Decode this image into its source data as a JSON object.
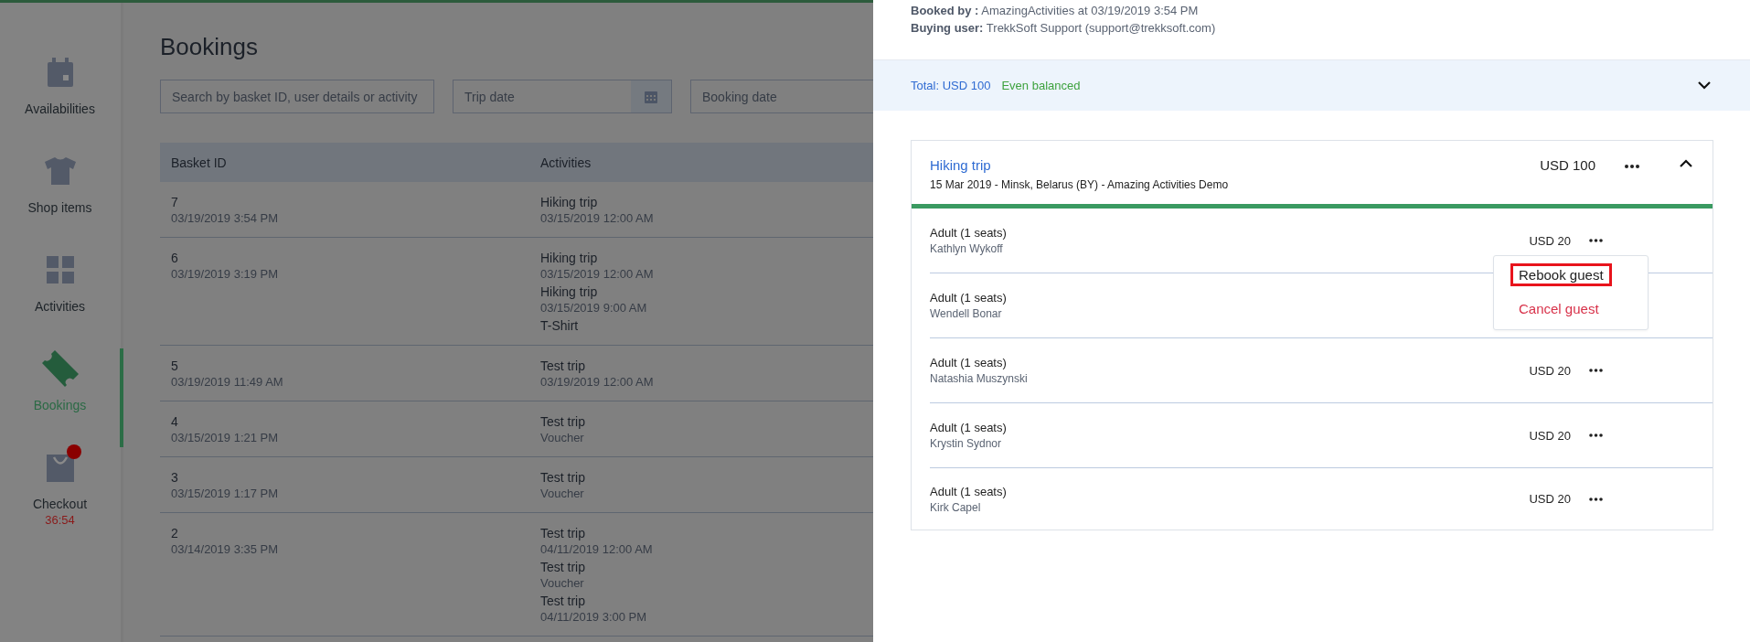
{
  "sidebar": {
    "items": [
      {
        "label": "Availabilities",
        "selected": false
      },
      {
        "label": "Shop items",
        "selected": false
      },
      {
        "label": "Activities",
        "selected": false
      },
      {
        "label": "Bookings",
        "selected": true
      },
      {
        "label": "Checkout",
        "selected": false,
        "badge": true,
        "timer": "36:54"
      }
    ]
  },
  "page": {
    "title": "Bookings",
    "filters": {
      "search": {
        "placeholder": "Search by basket ID, user details or activity"
      },
      "trip_date": {
        "placeholder": "Trip date"
      },
      "booking_date": {
        "placeholder": "Booking date"
      }
    },
    "table": {
      "columns": [
        "Basket ID",
        "Activities"
      ],
      "rows": [
        {
          "id": "7",
          "date": "03/19/2019 3:54 PM",
          "activities": [
            {
              "name": "Hiking trip",
              "detail": "03/15/2019 12:00 AM"
            }
          ]
        },
        {
          "id": "6",
          "date": "03/19/2019 3:19 PM",
          "activities": [
            {
              "name": "Hiking trip",
              "detail": "03/15/2019 12:00 AM"
            },
            {
              "name": "Hiking trip",
              "detail": "03/15/2019 9:00 AM"
            },
            {
              "name": "T-Shirt"
            }
          ]
        },
        {
          "id": "5",
          "date": "03/19/2019 11:49 AM",
          "activities": [
            {
              "name": "Test trip",
              "detail": "03/19/2019 12:00 AM"
            }
          ]
        },
        {
          "id": "4",
          "date": "03/15/2019 1:21 PM",
          "activities": [
            {
              "name": "Test trip",
              "detail": "Voucher"
            }
          ]
        },
        {
          "id": "3",
          "date": "03/15/2019 1:17 PM",
          "activities": [
            {
              "name": "Test trip",
              "detail": "Voucher"
            }
          ]
        },
        {
          "id": "2",
          "date": "03/14/2019 3:35 PM",
          "activities": [
            {
              "name": "Test trip",
              "detail": "04/11/2019 12:00 AM"
            },
            {
              "name": "Test trip",
              "detail": "Voucher"
            },
            {
              "name": "Test trip",
              "detail": "04/11/2019 3:00 PM"
            }
          ]
        }
      ]
    }
  },
  "detail": {
    "booked_by": "**Booked by :** AmazingActivities at 03/19/2019 3:54 PM",
    "buying_user": "**Buying user:** TrekkSoft Support (support@trekksoft.com)",
    "total": {
      "amount": "Total: USD 100",
      "balance": "Even balanced",
      "expanded": false
    },
    "item": {
      "title": "Hiking trip",
      "subtitle": "15 Mar 2019 - Minsk, Belarus (BY) - Amazing Activities Demo",
      "price": "USD 100",
      "expanded": true,
      "guests": [
        {
          "type": "Adult (1 seats)",
          "name": "Kathlyn Wykoff",
          "price": "USD 20",
          "menu": [
            {
              "label": "Rebook guest",
              "kind": "rebook",
              "highlighted": true
            },
            {
              "label": "Cancel guest",
              "kind": "cancel",
              "highlighted": false
            }
          ]
        },
        {
          "type": "Adult (1 seats)",
          "name": "Wendell Bonar"
        },
        {
          "type": "Adult (1 seats)",
          "name": "Natashia Muszynski",
          "price": "USD 20"
        },
        {
          "type": "Adult (1 seats)",
          "name": "Krystin Sydnor",
          "price": "USD 20"
        },
        {
          "type": "Adult (1 seats)",
          "name": "Kirk Capel",
          "price": "USD 20"
        }
      ]
    }
  }
}
